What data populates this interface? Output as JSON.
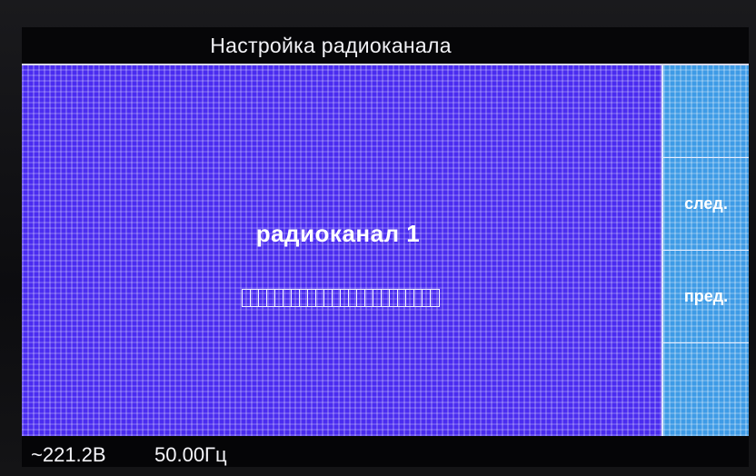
{
  "header": {
    "title": "Настройка радиоканала"
  },
  "main": {
    "channel_label": "радиоканал 1",
    "id_field": {
      "cell_count": 24
    }
  },
  "side_panel": {
    "keys": [
      {
        "label": ""
      },
      {
        "label": "след."
      },
      {
        "label": "пред."
      },
      {
        "label": ""
      }
    ]
  },
  "status": {
    "voltage": "~221.2В",
    "frequency": "50.00Гц"
  },
  "colors": {
    "main_panel": "#4a2cf0",
    "side_panel": "#3e9be6",
    "background": "#050507",
    "text": "#ffffff"
  }
}
